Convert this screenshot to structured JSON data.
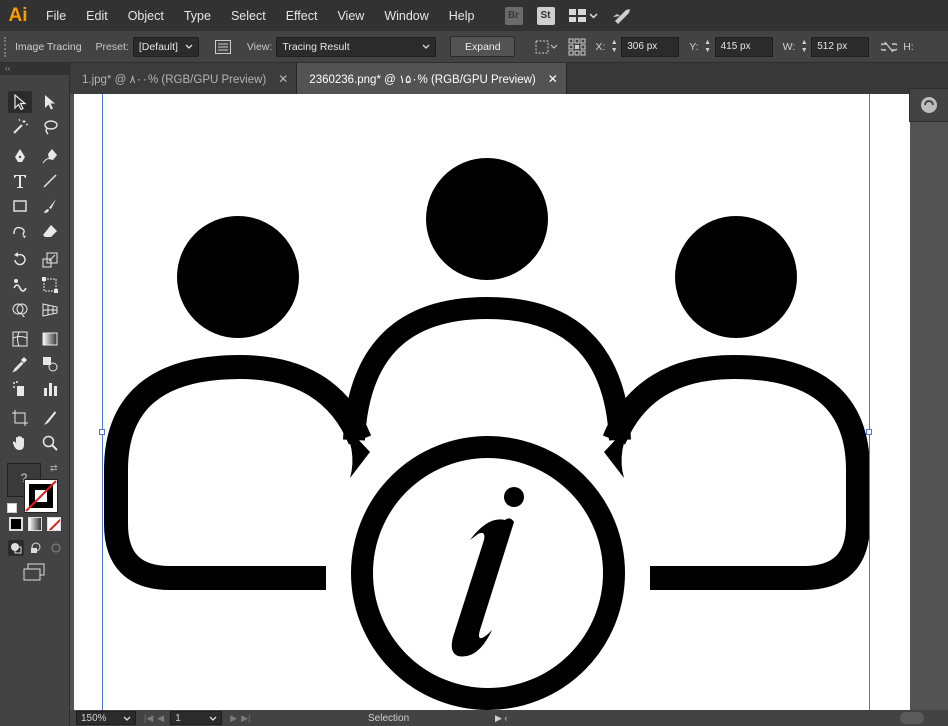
{
  "app": {
    "logo": "Ai",
    "accent": "#ff9a00"
  },
  "menu": {
    "items": [
      "File",
      "Edit",
      "Object",
      "Type",
      "Select",
      "Effect",
      "View",
      "Window",
      "Help"
    ],
    "bridge": "Br",
    "stock": "St"
  },
  "control_bar": {
    "panel_title": "Image Tracing",
    "preset_label": "Preset:",
    "preset_value": "[Default]",
    "view_label": "View:",
    "view_value": "Tracing Result",
    "expand_label": "Expand",
    "x_label": "X:",
    "x_value": "306 px",
    "y_label": "Y:",
    "y_value": "415 px",
    "w_label": "W:",
    "w_value": "512 px",
    "h_label": "H:"
  },
  "tabs": [
    {
      "label": "1.jpg* @ ۸۰۰% (RGB/GPU Preview)",
      "close": "✕",
      "active": false
    },
    {
      "label": "2360236.png* @ ۱۵۰% (RGB/GPU Preview)",
      "close": "✕",
      "active": true
    }
  ],
  "tool_panel": {
    "collapse_glyph": "‹‹",
    "fill_unknown": "?"
  },
  "status_bar": {
    "zoom": "150%",
    "page": "1",
    "tool": "Selection"
  },
  "colors": {
    "ui_dark": "#323232",
    "ui_mid": "#434343",
    "canvas_bg": "#535353",
    "guide": "#4a7bd8"
  }
}
